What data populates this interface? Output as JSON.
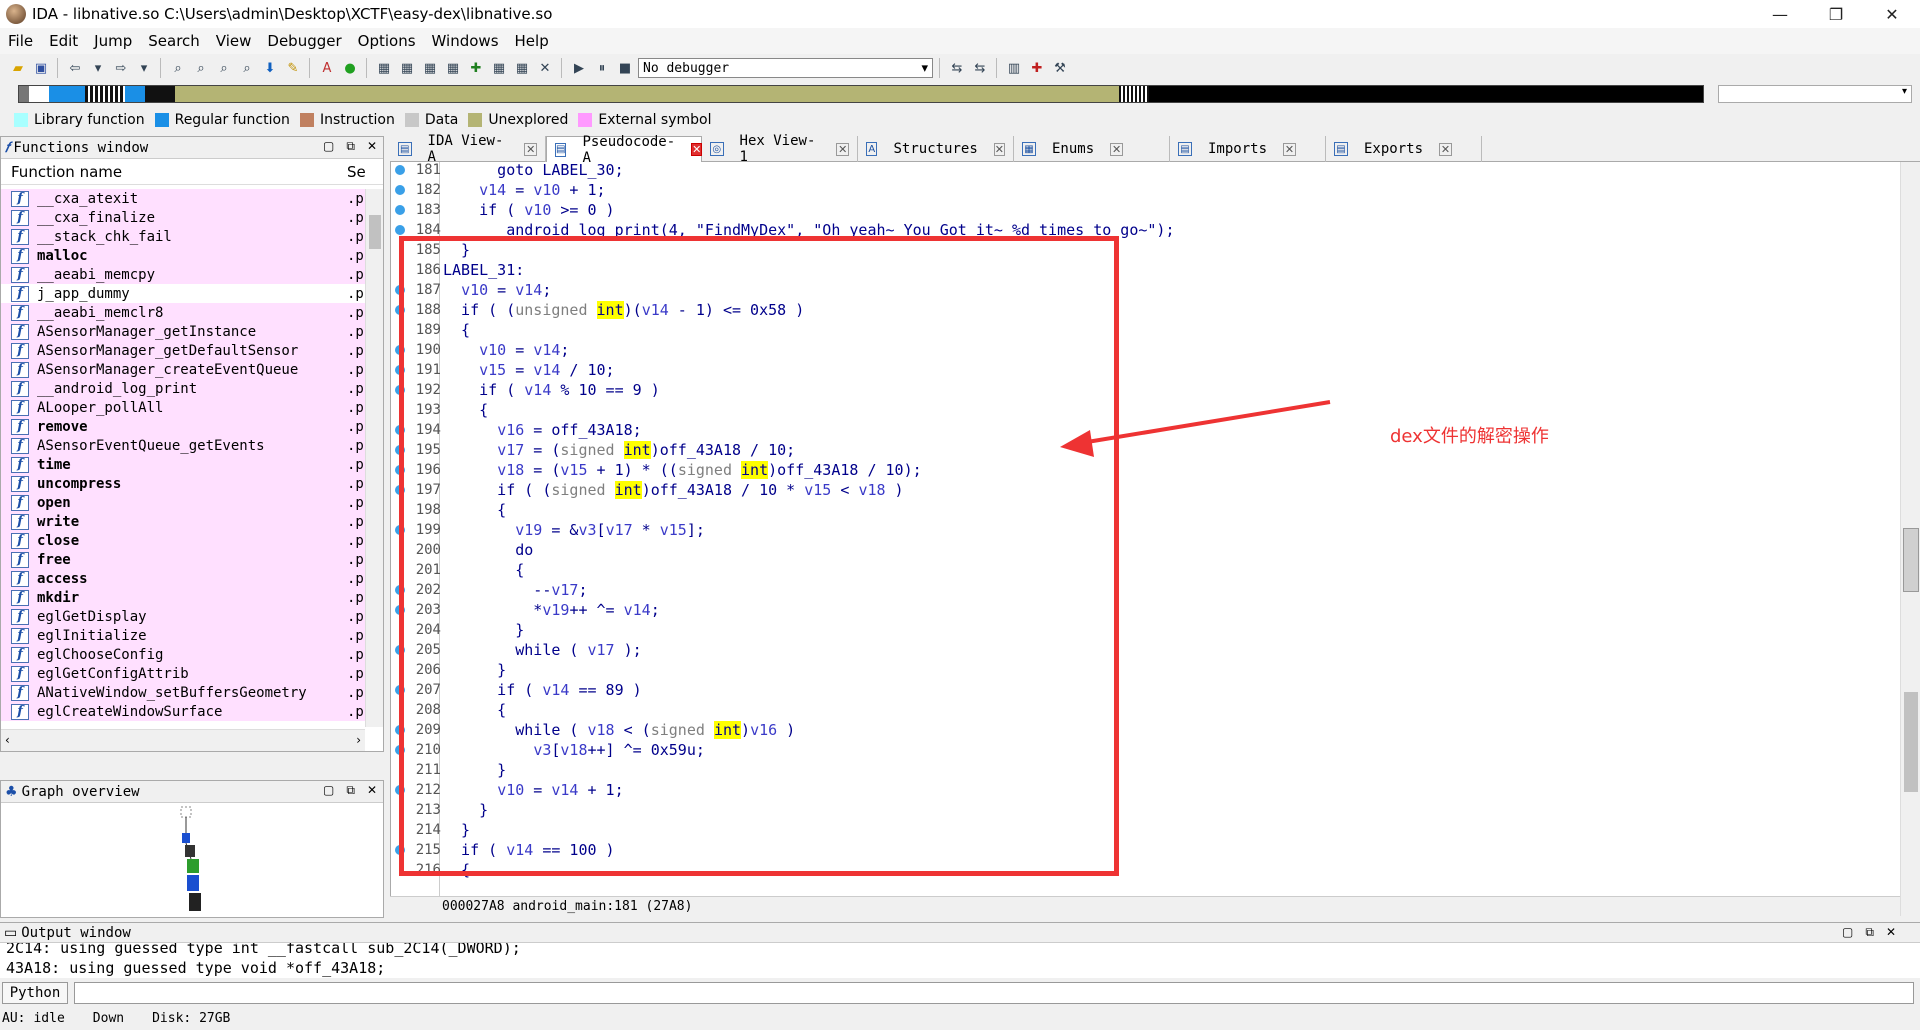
{
  "window": {
    "title": "IDA - libnative.so C:\\Users\\admin\\Desktop\\XCTF\\easy-dex\\libnative.so"
  },
  "menu": [
    "File",
    "Edit",
    "Jump",
    "Search",
    "View",
    "Debugger",
    "Options",
    "Windows",
    "Help"
  ],
  "toolbar": {
    "debugger": "No debugger"
  },
  "legend": [
    {
      "label": "Library function",
      "color": "#a8ffff"
    },
    {
      "label": "Regular function",
      "color": "#1a8fe6"
    },
    {
      "label": "Instruction",
      "color": "#c08060"
    },
    {
      "label": "Data",
      "color": "#c8c8c8"
    },
    {
      "label": "Unexplored",
      "color": "#b4b474"
    },
    {
      "label": "External symbol",
      "color": "#ff99ff"
    }
  ],
  "functions": {
    "title": "Functions window",
    "col_name": "Function name",
    "col_seg": "Se",
    "items": [
      {
        "name": "__cxa_atexit",
        "seg": ".p",
        "bold": false,
        "white": false
      },
      {
        "name": "__cxa_finalize",
        "seg": ".p",
        "bold": false,
        "white": false
      },
      {
        "name": "__stack_chk_fail",
        "seg": ".p",
        "bold": false,
        "white": false
      },
      {
        "name": "malloc",
        "seg": ".p",
        "bold": true,
        "white": false
      },
      {
        "name": "__aeabi_memcpy",
        "seg": ".p",
        "bold": false,
        "white": false
      },
      {
        "name": "j_app_dummy",
        "seg": ".p",
        "bold": false,
        "white": true
      },
      {
        "name": "__aeabi_memclr8",
        "seg": ".p",
        "bold": false,
        "white": false
      },
      {
        "name": "ASensorManager_getInstance",
        "seg": ".p",
        "bold": false,
        "white": false
      },
      {
        "name": "ASensorManager_getDefaultSensor",
        "seg": ".p",
        "bold": false,
        "white": false
      },
      {
        "name": "ASensorManager_createEventQueue",
        "seg": ".p",
        "bold": false,
        "white": false
      },
      {
        "name": "__android_log_print",
        "seg": ".p",
        "bold": false,
        "white": false
      },
      {
        "name": "ALooper_pollAll",
        "seg": ".p",
        "bold": false,
        "white": false
      },
      {
        "name": "remove",
        "seg": ".p",
        "bold": true,
        "white": false
      },
      {
        "name": "ASensorEventQueue_getEvents",
        "seg": ".p",
        "bold": false,
        "white": false
      },
      {
        "name": "time",
        "seg": ".p",
        "bold": true,
        "white": false
      },
      {
        "name": "uncompress",
        "seg": ".p",
        "bold": true,
        "white": false
      },
      {
        "name": "open",
        "seg": ".p",
        "bold": true,
        "white": false
      },
      {
        "name": "write",
        "seg": ".p",
        "bold": true,
        "white": false
      },
      {
        "name": "close",
        "seg": ".p",
        "bold": true,
        "white": false
      },
      {
        "name": "free",
        "seg": ".p",
        "bold": true,
        "white": false
      },
      {
        "name": "access",
        "seg": ".p",
        "bold": true,
        "white": false
      },
      {
        "name": "mkdir",
        "seg": ".p",
        "bold": true,
        "white": false
      },
      {
        "name": "eglGetDisplay",
        "seg": ".p",
        "bold": false,
        "white": false
      },
      {
        "name": "eglInitialize",
        "seg": ".p",
        "bold": false,
        "white": false
      },
      {
        "name": "eglChooseConfig",
        "seg": ".p",
        "bold": false,
        "white": false
      },
      {
        "name": "eglGetConfigAttrib",
        "seg": ".p",
        "bold": false,
        "white": false
      },
      {
        "name": "ANativeWindow_setBuffersGeometry",
        "seg": ".p",
        "bold": false,
        "white": false
      },
      {
        "name": "eglCreateWindowSurface",
        "seg": ".p",
        "bold": false,
        "white": false
      }
    ]
  },
  "graph": {
    "title": "Graph overview"
  },
  "tabs": [
    {
      "label": "IDA View-A",
      "icon": "ida-view-icon",
      "active": false
    },
    {
      "label": "Pseudocode-A",
      "icon": "pseudocode-icon",
      "active": true
    },
    {
      "label": "Hex View-1",
      "icon": "hex-view-icon",
      "active": false
    },
    {
      "label": "Structures",
      "icon": "structures-icon",
      "active": false
    },
    {
      "label": "Enums",
      "icon": "enums-icon",
      "active": false
    },
    {
      "label": "Imports",
      "icon": "imports-icon",
      "active": false
    },
    {
      "label": "Exports",
      "icon": "exports-icon",
      "active": false
    }
  ],
  "code": {
    "lines": [
      {
        "n": "181",
        "dot": true,
        "html": "      goto LABEL_30;"
      },
      {
        "n": "182",
        "dot": true,
        "html": "    <span class='var'>v14</span> = <span class='var'>v10</span> + 1;"
      },
      {
        "n": "183",
        "dot": true,
        "html": "    if ( <span class='var'>v10</span> >= 0 )"
      },
      {
        "n": "184",
        "dot": true,
        "html": "      _android_log_print(4, \"FindMyDex\", \"Oh yeah~ You Got it~ %d times to go~\");"
      },
      {
        "n": "185",
        "dot": false,
        "html": "  }"
      },
      {
        "n": "186",
        "dot": false,
        "html": "LABEL_31:"
      },
      {
        "n": "187",
        "dot": true,
        "html": "  <span class='var'>v10</span> = <span class='var'>v14</span>;"
      },
      {
        "n": "188",
        "dot": true,
        "html": "  if ( (<span class='gray'>unsigned</span> <span class='hl'>int</span>)(<span class='var'>v14</span> - 1) <= 0x58 )"
      },
      {
        "n": "189",
        "dot": false,
        "html": "  {"
      },
      {
        "n": "190",
        "dot": true,
        "html": "    <span class='var'>v10</span> = <span class='var'>v14</span>;"
      },
      {
        "n": "191",
        "dot": true,
        "html": "    <span class='var'>v15</span> = <span class='var'>v14</span> / 10;"
      },
      {
        "n": "192",
        "dot": true,
        "html": "    if ( <span class='var'>v14</span> % 10 == 9 )"
      },
      {
        "n": "193",
        "dot": false,
        "html": "    {"
      },
      {
        "n": "194",
        "dot": true,
        "html": "      <span class='var'>v16</span> = off_43A18;"
      },
      {
        "n": "195",
        "dot": true,
        "html": "      <span class='var'>v17</span> = (<span class='gray'>signed</span> <span class='hl'>int</span>)off_43A18 / 10;"
      },
      {
        "n": "196",
        "dot": true,
        "html": "      <span class='var'>v18</span> = (<span class='var'>v15</span> + 1) * ((<span class='gray'>signed</span> <span class='hl'>int</span>)off_43A18 / 10);"
      },
      {
        "n": "197",
        "dot": true,
        "html": "      if ( (<span class='gray'>signed</span> <span class='hl'>int</span>)off_43A18 / 10 * <span class='var'>v15</span> < <span class='var'>v18</span> )"
      },
      {
        "n": "198",
        "dot": false,
        "html": "      {"
      },
      {
        "n": "199",
        "dot": true,
        "html": "        <span class='var'>v19</span> = &amp;<span class='var'>v3</span>[<span class='var'>v17</span> * <span class='var'>v15</span>];"
      },
      {
        "n": "200",
        "dot": false,
        "html": "        do"
      },
      {
        "n": "201",
        "dot": false,
        "html": "        {"
      },
      {
        "n": "202",
        "dot": true,
        "html": "          --<span class='var'>v17</span>;"
      },
      {
        "n": "203",
        "dot": true,
        "html": "          *<span class='var'>v19</span>++ ^= <span class='var'>v14</span>;"
      },
      {
        "n": "204",
        "dot": false,
        "html": "        }"
      },
      {
        "n": "205",
        "dot": true,
        "html": "        while ( <span class='var'>v17</span> );"
      },
      {
        "n": "206",
        "dot": false,
        "html": "      }"
      },
      {
        "n": "207",
        "dot": true,
        "html": "      if ( <span class='var'>v14</span> == 89 )"
      },
      {
        "n": "208",
        "dot": false,
        "html": "      {"
      },
      {
        "n": "209",
        "dot": true,
        "html": "        while ( <span class='var'>v18</span> < (<span class='gray'>signed</span> <span class='hl'>int</span>)<span class='var'>v16</span> )"
      },
      {
        "n": "210",
        "dot": true,
        "html": "          <span class='var'>v3</span>[<span class='var'>v18</span>++] ^= 0x59u;"
      },
      {
        "n": "211",
        "dot": false,
        "html": "      }"
      },
      {
        "n": "212",
        "dot": true,
        "html": "      <span class='var'>v10</span> = <span class='var'>v14</span> + 1;"
      },
      {
        "n": "213",
        "dot": false,
        "html": "    }"
      },
      {
        "n": "214",
        "dot": false,
        "html": "  }"
      },
      {
        "n": "215",
        "dot": true,
        "html": "  if ( <span class='var'>v14</span> == 100 )"
      },
      {
        "n": "216",
        "dot": false,
        "html": "  {"
      }
    ],
    "status": "000027A8 android_main:181 (27A8)"
  },
  "annotation": "dex文件的解密操作",
  "output": {
    "title": "Output window",
    "line1": "2C14: using guessed type int __fastcall sub_2C14(_DWORD);",
    "line2": "43A18: using guessed type void *off_43A18;"
  },
  "python_button": "Python",
  "status": {
    "au": "AU:",
    "state": "idle",
    "dir": "Down",
    "disk": "Disk: 27GB"
  }
}
